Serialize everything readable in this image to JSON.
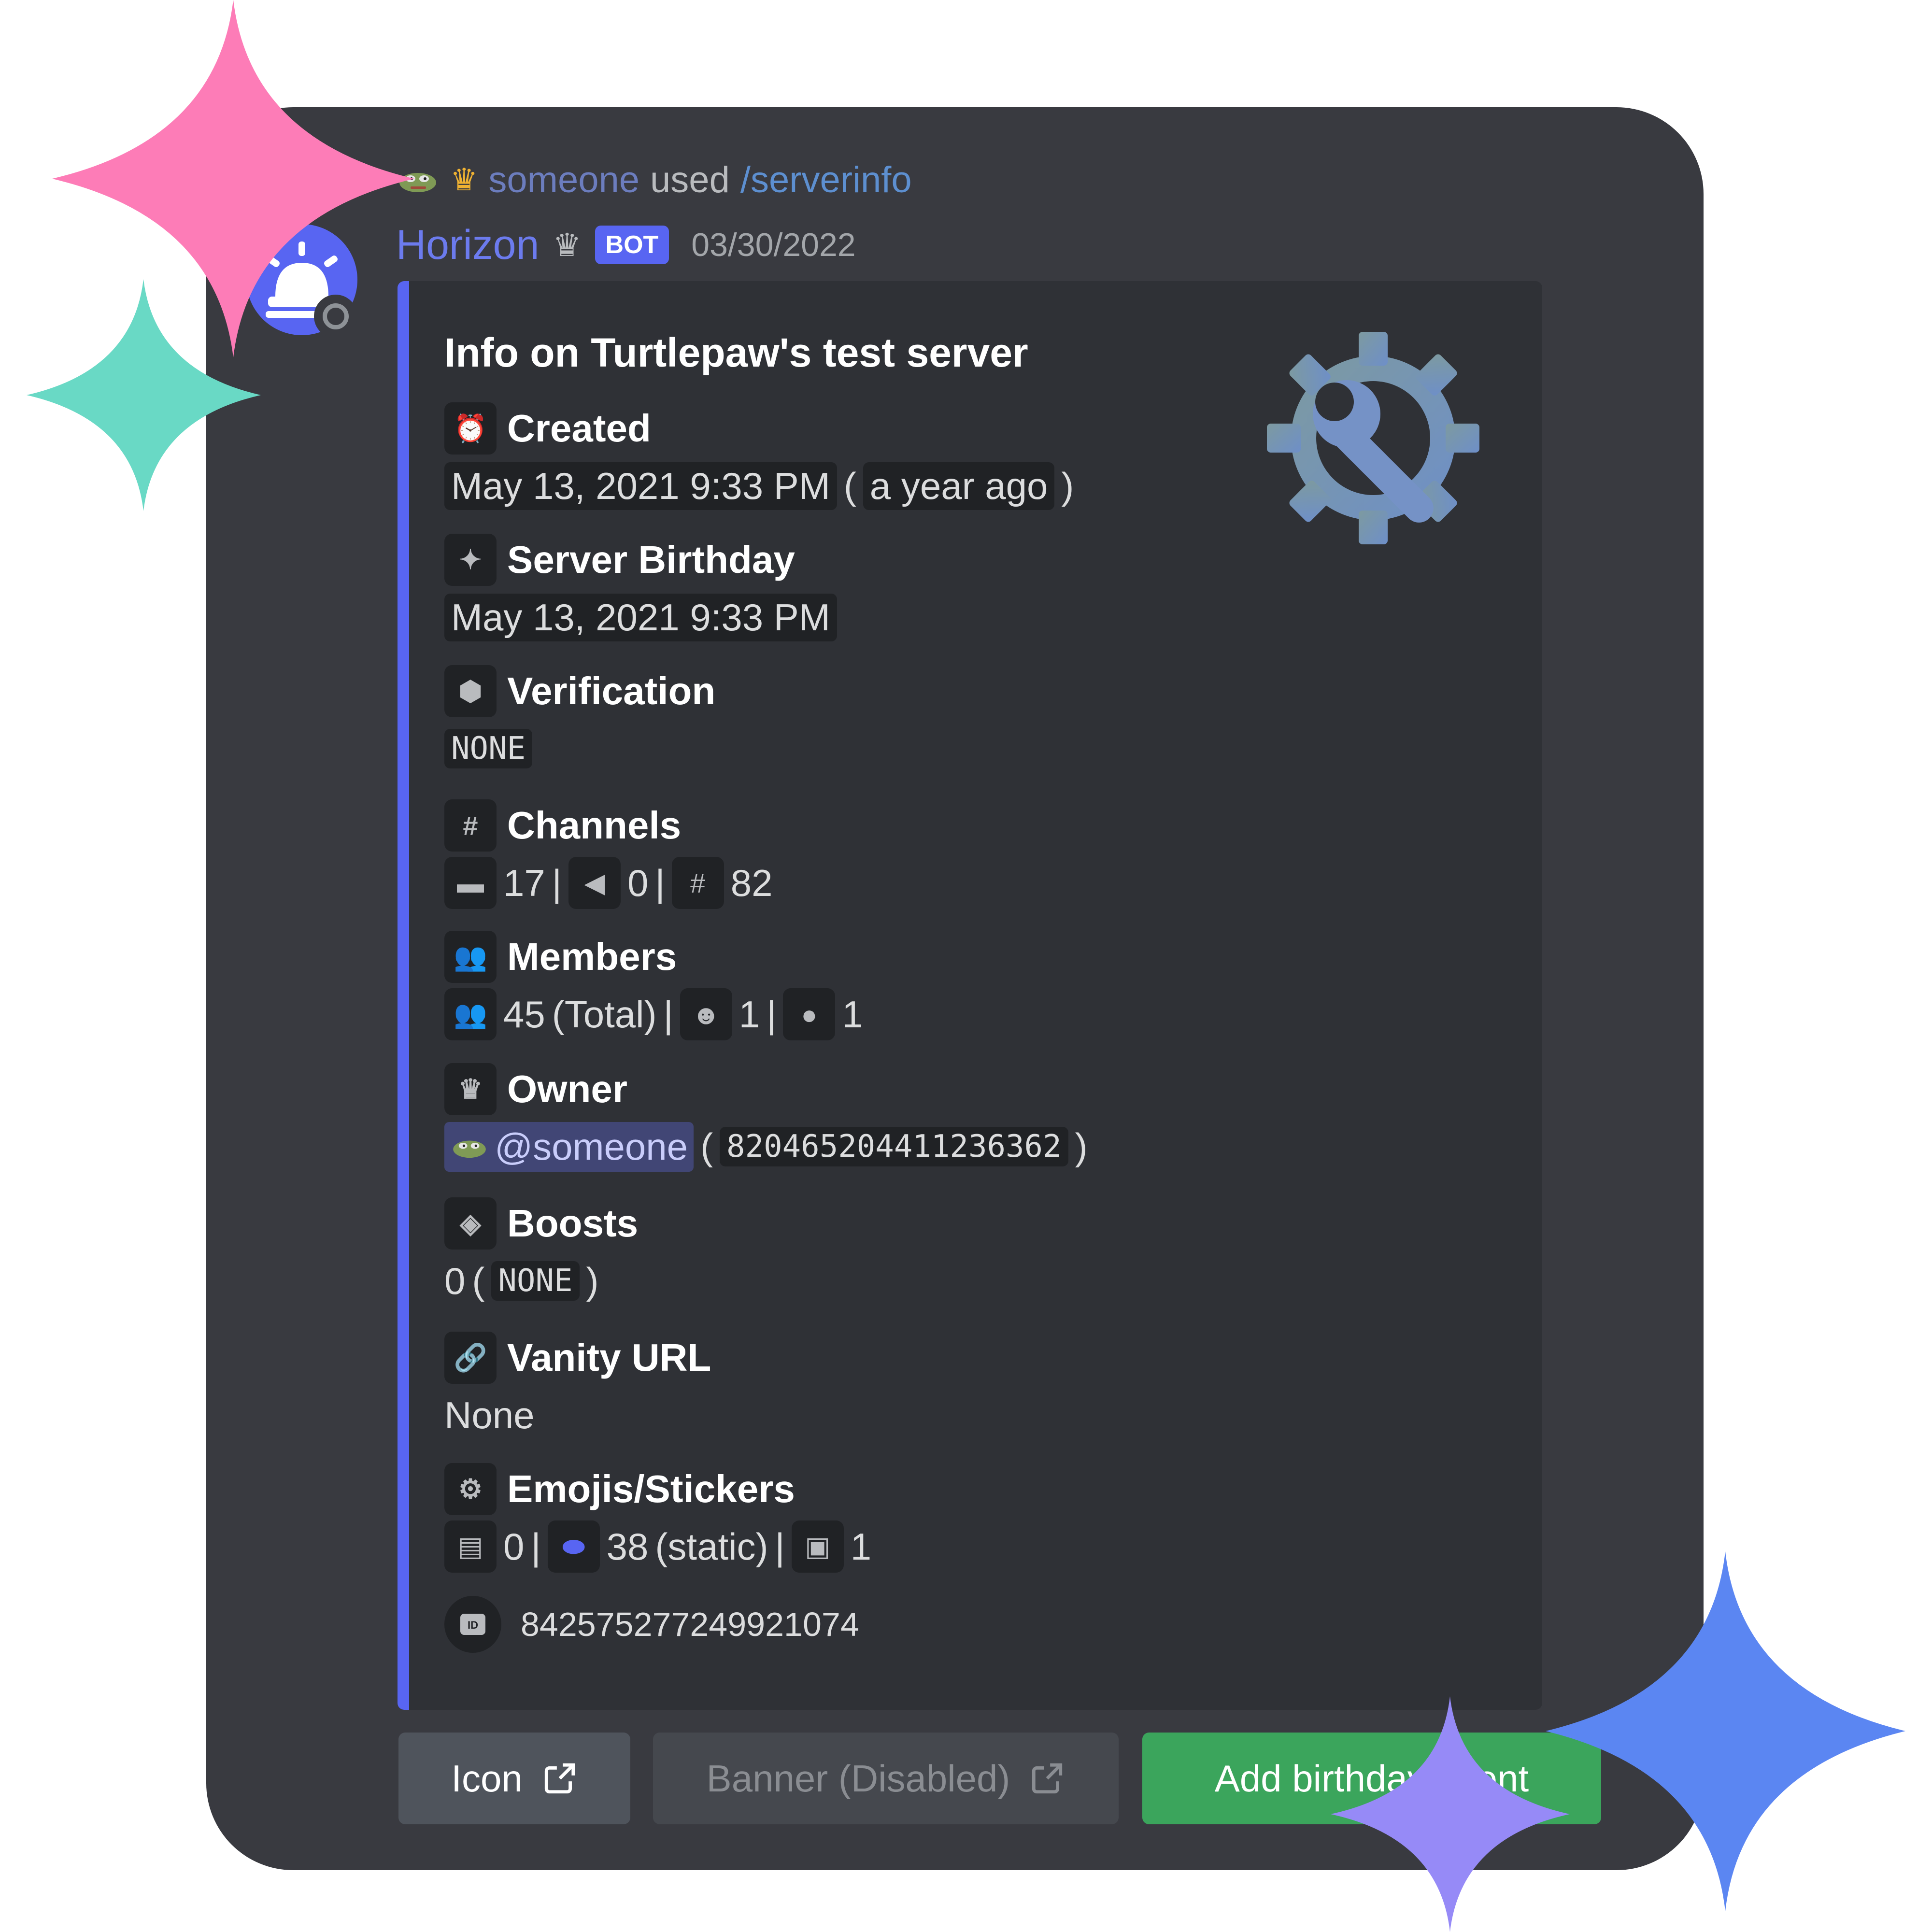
{
  "colors": {
    "accent": "#5865f2",
    "embed_bg": "#2f3136",
    "card_bg": "#393a40",
    "success": "#3ba55c",
    "star_pink": "#fd7cb7",
    "star_teal": "#69d9c5",
    "star_blue": "#5b86f2",
    "star_purple": "#968af7"
  },
  "reply": {
    "user": "someone",
    "used": "used",
    "command": "/serverinfo",
    "icons": [
      "pepe-emoji",
      "crown-icon"
    ]
  },
  "author": {
    "name": "Horizon",
    "tag": "BOT",
    "timestamp": "03/30/2022",
    "avatar": "horizon-bot-avatar"
  },
  "embed": {
    "title": "Info on Turtlepaw's test server",
    "thumbnail": "gear-wrench-icon",
    "fields": {
      "created": {
        "name": "Created",
        "icon": "alarm-clock-icon",
        "value": "May 13, 2021 9:33 PM",
        "relative": "a year ago"
      },
      "birthday": {
        "name": "Server Birthday",
        "icon": "party-popper-icon",
        "value": "May 13, 2021 9:33 PM"
      },
      "verification": {
        "name": "Verification",
        "icon": "shield-icon",
        "value": "NONE"
      },
      "channels": {
        "name": "Channels",
        "icon": "hashtag-icon",
        "categories": "17",
        "voice": "0",
        "text": "82"
      },
      "members": {
        "name": "Members",
        "icon": "members-icon",
        "total": "45",
        "total_label": "(Total)",
        "bots": "1",
        "humans": "1"
      },
      "owner": {
        "name": "Owner",
        "icon": "crown-icon",
        "mention": "@someone",
        "id": "820465204411236362"
      },
      "boosts": {
        "name": "Boosts",
        "icon": "boost-gem-icon",
        "count": "0",
        "tier": "NONE"
      },
      "vanity": {
        "name": "Vanity URL",
        "icon": "link-icon",
        "value": "None"
      },
      "emojis": {
        "name": "Emojis/Stickers",
        "icon": "settings-icon",
        "stickers": "0",
        "static": "38",
        "static_label": "(static)",
        "animated": "1"
      }
    },
    "footer": {
      "icon": "id-icon",
      "id": "842575277249921074"
    }
  },
  "buttons": {
    "icon": "Icon",
    "banner": "Banner (Disabled)",
    "birthday": "Add birthday event"
  }
}
